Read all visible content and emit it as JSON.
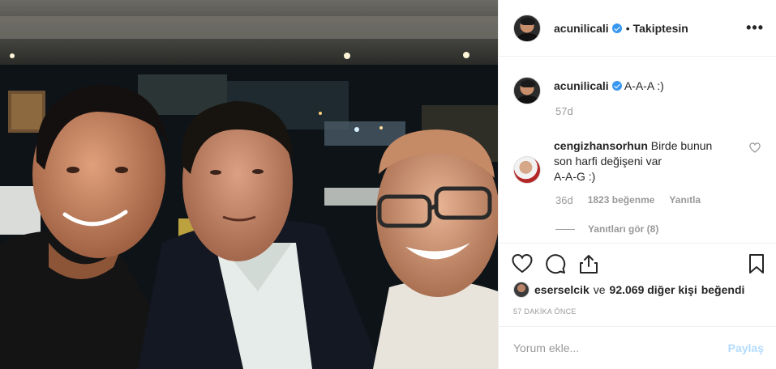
{
  "post": {
    "photo_alt": "Three men smiling in a selfie at a restaurant at night"
  },
  "header": {
    "username": "acunilicali",
    "separator": "•",
    "follow_status": "Takiptesin",
    "more_label": "•••"
  },
  "caption": {
    "username": "acunilicali",
    "text": "A-A-A :)",
    "age": "57d"
  },
  "comment": {
    "username": "cengizhansorhun",
    "text_line1": "Birde bunun",
    "text_line2": "son harfi değişeni var",
    "text_line3": "A-A-G :)",
    "age": "36d",
    "likes": "1823 beğenme",
    "reply": "Yanıtla",
    "view_replies": "Yanıtları gör (8)"
  },
  "likes": {
    "first_user": "eserselcik",
    "connector": "ve",
    "others": "92.069 diğer kişi",
    "suffix": "beğendi"
  },
  "time_ago": "57 DAKİKA ÖNCE",
  "add_comment": {
    "placeholder": "Yorum ekle...",
    "post_label": "Paylaş"
  },
  "colors": {
    "verified": "#3897f0",
    "post_button": "#b3dbff",
    "muted": "#999999",
    "text": "#262626"
  }
}
